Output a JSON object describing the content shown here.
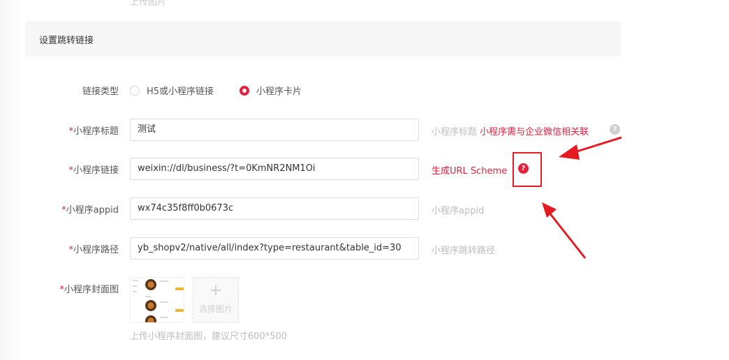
{
  "top_cut_text": "上传图片",
  "section": {
    "title": "设置跳转链接"
  },
  "link_type": {
    "label": "链接类型",
    "options": [
      {
        "label": "H5或小程序链接",
        "selected": false
      },
      {
        "label": "小程序卡片",
        "selected": true
      }
    ]
  },
  "fields": {
    "title": {
      "required_mark": "*",
      "label": "小程序标题",
      "value": "测试",
      "hint": "小程序标题",
      "hint_red": "小程序需与企业微信相关联"
    },
    "link": {
      "required_mark": "*",
      "label": "小程序链接",
      "value": "weixin://dl/business/?t=0KmNR2NM1Oi",
      "action": "生成URL Scheme"
    },
    "appid": {
      "required_mark": "*",
      "label": "小程序appid",
      "value": "wx74c35f8ff0b0673c",
      "hint": "小程序appid"
    },
    "path": {
      "required_mark": "*",
      "label": "小程序路径",
      "value": "yb_shopv2/native/all/index?type=restaurant&table_id=30",
      "hint": "小程序跳转路径"
    },
    "cover": {
      "required_mark": "*",
      "label": "小程序封面图",
      "upload_label": "选择图片",
      "hint": "上传小程序封面图，建议尺寸600*500"
    }
  },
  "help_icon_glyph": "?",
  "accent_color": "#e5203d",
  "annotation_color": "#e51b23"
}
